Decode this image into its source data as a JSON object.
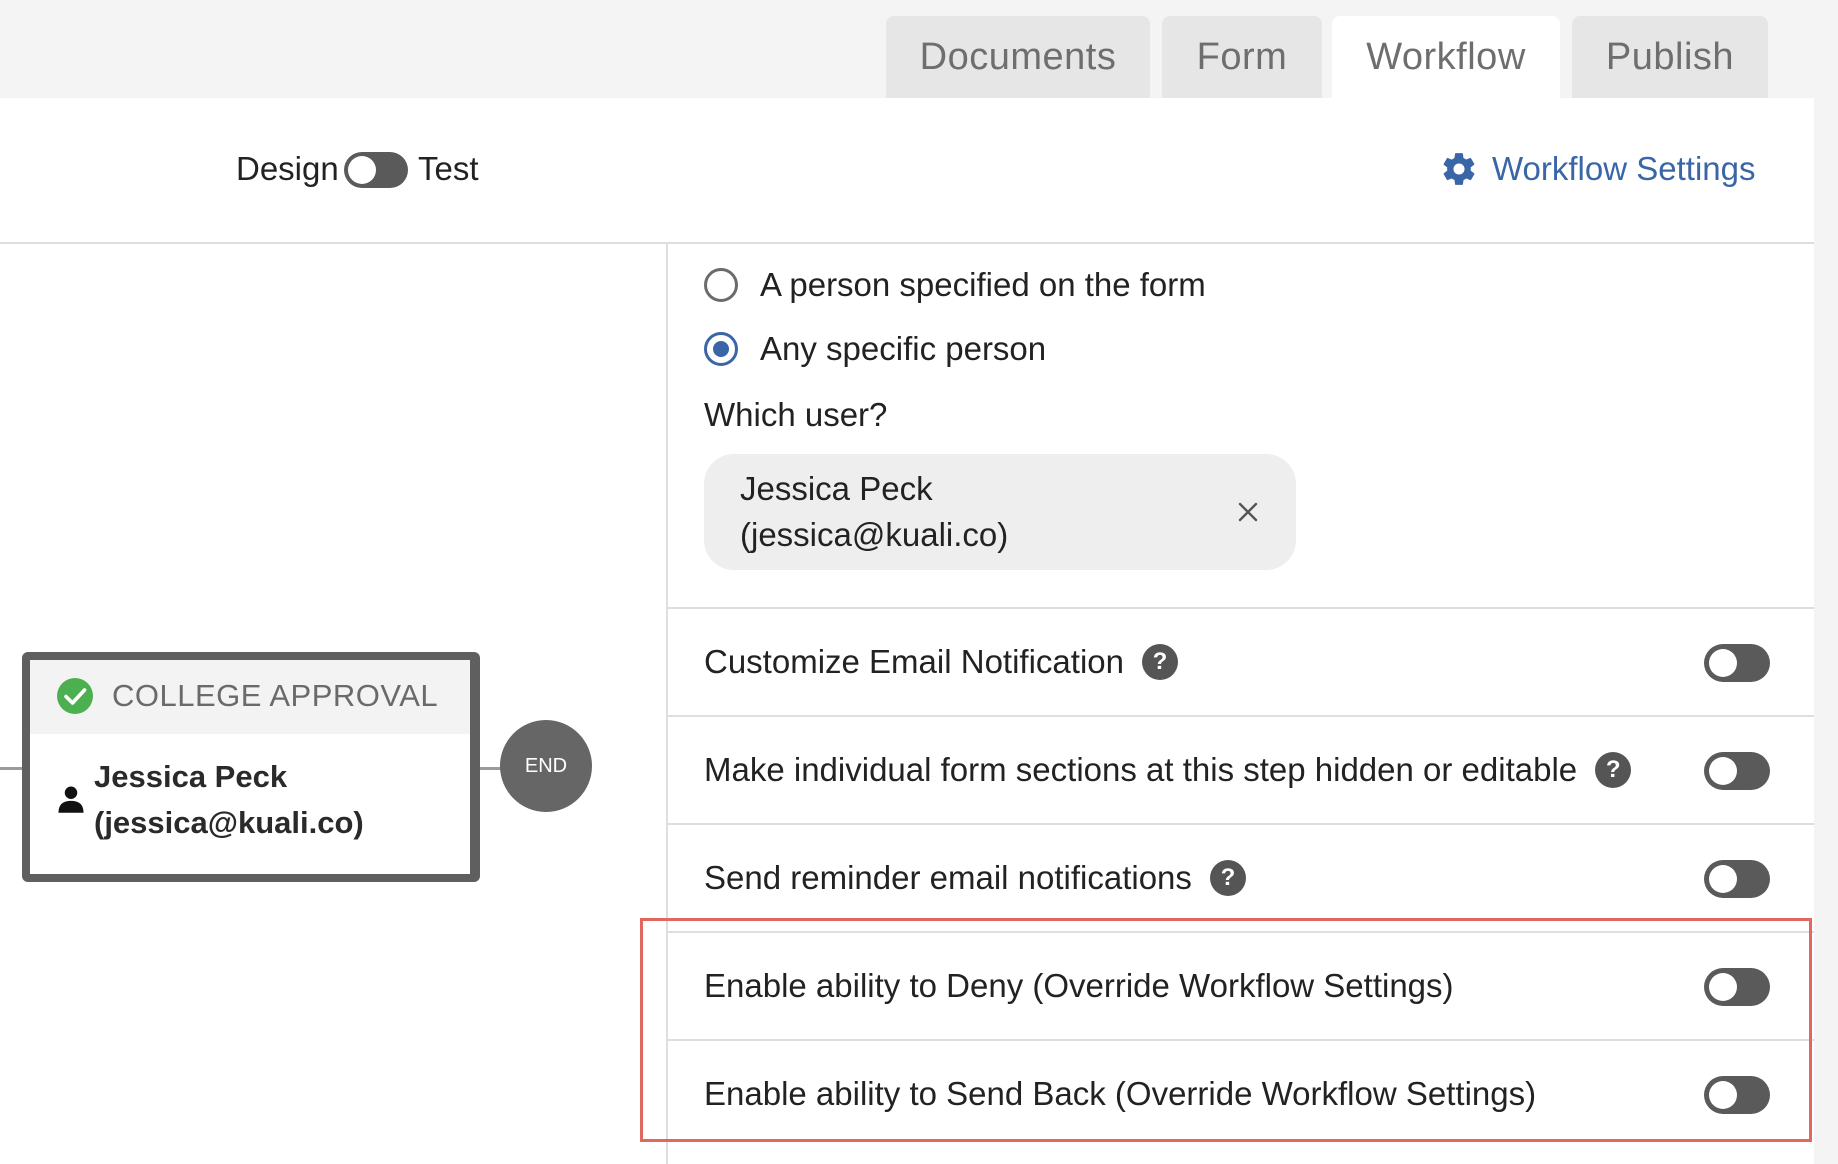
{
  "tabs": [
    {
      "label": "Documents",
      "active": false
    },
    {
      "label": "Form",
      "active": false
    },
    {
      "label": "Workflow",
      "active": true
    },
    {
      "label": "Publish",
      "active": false
    }
  ],
  "mode": {
    "design_label": "Design",
    "test_label": "Test",
    "toggle_on": false
  },
  "header": {
    "settings_label": "Workflow Settings",
    "settings_icon": "gear-icon"
  },
  "canvas": {
    "step": {
      "title": "COLLEGE APPROVAL",
      "status_icon": "check-circle-icon",
      "assignee_name": "Jessica Peck",
      "assignee_email": "(jessica@kuali.co)",
      "assignee_icon": "person-icon"
    },
    "end_label": "END"
  },
  "assignment": {
    "options": [
      {
        "label": "A person specified on the form",
        "selected": false
      },
      {
        "label": "Any specific person",
        "selected": true
      }
    ],
    "which_user_label": "Which user?",
    "selected_user": {
      "name": "Jessica Peck",
      "email": "(jessica@kuali.co)"
    }
  },
  "settings": [
    {
      "label": "Customize Email Notification",
      "help": true,
      "enabled": false
    },
    {
      "label": "Make individual form sections at this step hidden or editable",
      "help": true,
      "enabled": false
    },
    {
      "label": "Send reminder email notifications",
      "help": true,
      "enabled": false
    },
    {
      "label": "Enable ability to Deny (Override Workflow Settings)",
      "help": false,
      "enabled": false
    },
    {
      "label": "Enable ability to Send Back (Override Workflow Settings)",
      "help": false,
      "enabled": false
    }
  ],
  "help_glyph": "?",
  "colors": {
    "accent": "#3a66a8",
    "highlight": "#e0685f",
    "success": "#4caf50",
    "toggle_off": "#5a5a5a"
  }
}
